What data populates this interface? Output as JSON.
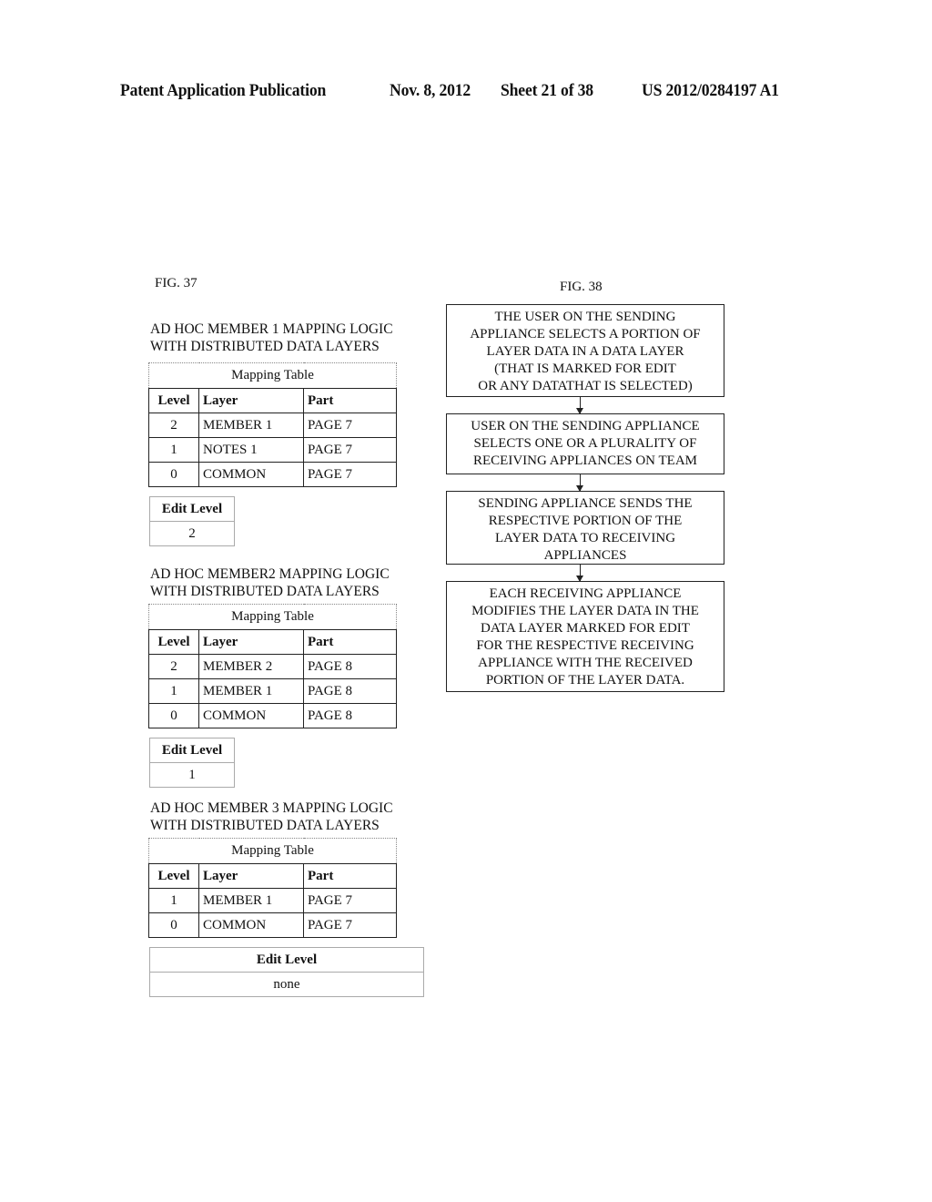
{
  "header": {
    "publication": "Patent Application Publication",
    "date": "Nov. 8, 2012",
    "sheet": "Sheet 21 of 38",
    "number": "US 2012/0284197 A1"
  },
  "fig37": {
    "label": "FIG. 37",
    "members": [
      {
        "caption_line1": "AD HOC MEMBER 1  MAPPING LOGIC",
        "caption_line2": "WITH DISTRIBUTED DATA LAYERS",
        "table_title": "Mapping Table",
        "columns": [
          "Level",
          "Layer",
          "Part"
        ],
        "rows": [
          {
            "level": "2",
            "layer": "MEMBER 1",
            "part": "PAGE 7"
          },
          {
            "level": "1",
            "layer": "NOTES 1",
            "part": "PAGE 7"
          },
          {
            "level": "0",
            "layer": "COMMON",
            "part": "PAGE 7"
          }
        ],
        "edit_label": "Edit Level",
        "edit_value": "2"
      },
      {
        "caption_line1": "AD HOC MEMBER2  MAPPING LOGIC",
        "caption_line2": "WITH DISTRIBUTED DATA LAYERS",
        "table_title": "Mapping Table",
        "columns": [
          "Level",
          "Layer",
          "Part"
        ],
        "rows": [
          {
            "level": "2",
            "layer": "MEMBER 2",
            "part": "PAGE 8"
          },
          {
            "level": "1",
            "layer": "MEMBER 1",
            "part": "PAGE 8"
          },
          {
            "level": "0",
            "layer": "COMMON",
            "part": "PAGE 8"
          }
        ],
        "edit_label": "Edit Level",
        "edit_value": "1"
      },
      {
        "caption_line1": "AD HOC MEMBER 3  MAPPING LOGIC",
        "caption_line2": "WITH DISTRIBUTED DATA LAYERS",
        "table_title": "Mapping Table",
        "columns": [
          "Level",
          "Layer",
          "Part"
        ],
        "rows": [
          {
            "level": "1",
            "layer": "MEMBER 1",
            "part": "PAGE 7"
          },
          {
            "level": "0",
            "layer": "COMMON",
            "part": "PAGE 7"
          }
        ],
        "edit_label": "Edit Level",
        "edit_value": "none"
      }
    ]
  },
  "fig38": {
    "label": "FIG. 38",
    "steps": [
      "THE USER ON THE SENDING\nAPPLIANCE SELECTS A PORTION OF\nLAYER DATA IN A DATA LAYER\n(THAT IS MARKED FOR EDIT\nOR ANY DATATHAT IS SELECTED)",
      "USER ON THE SENDING APPLIANCE\nSELECTS ONE OR A PLURALITY OF\nRECEIVING APPLIANCES ON TEAM",
      "SENDING APPLIANCE SENDS THE\nRESPECTIVE PORTION OF THE\nLAYER DATA TO RECEIVING\nAPPLIANCES",
      "EACH RECEIVING APPLIANCE\nMODIFIES THE LAYER DATA IN THE\nDATA LAYER MARKED FOR EDIT\nFOR THE RESPECTIVE RECEIVING\nAPPLIANCE WITH THE RECEIVED\nPORTION OF THE LAYER DATA."
    ]
  }
}
